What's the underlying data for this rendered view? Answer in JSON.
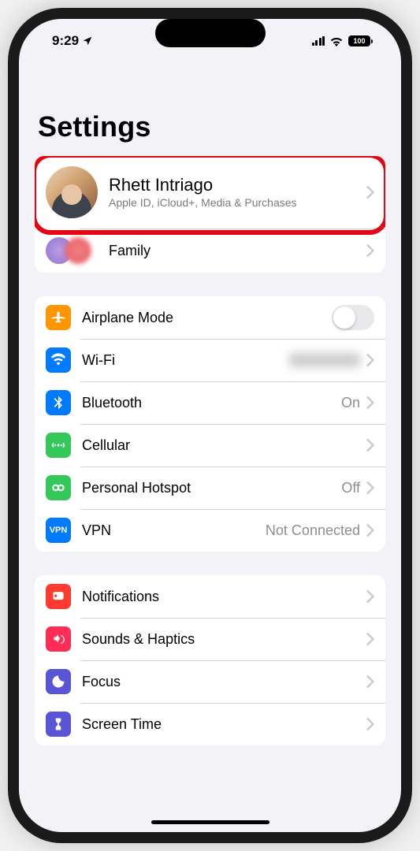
{
  "status_bar": {
    "time": "9:29",
    "battery": "100"
  },
  "page": {
    "title": "Settings"
  },
  "profile": {
    "name": "Rhett Intriago",
    "subtitle": "Apple ID, iCloud+, Media & Purchases"
  },
  "family": {
    "label": "Family"
  },
  "network": {
    "airplane": "Airplane Mode",
    "wifi": {
      "label": "Wi-Fi",
      "value": ""
    },
    "bluetooth": {
      "label": "Bluetooth",
      "value": "On"
    },
    "cellular": "Cellular",
    "hotspot": {
      "label": "Personal Hotspot",
      "value": "Off"
    },
    "vpn": {
      "label": "VPN",
      "value": "Not Connected",
      "badge": "VPN"
    }
  },
  "general": {
    "notifications": "Notifications",
    "sounds": "Sounds & Haptics",
    "focus": "Focus",
    "screentime": "Screen Time"
  }
}
